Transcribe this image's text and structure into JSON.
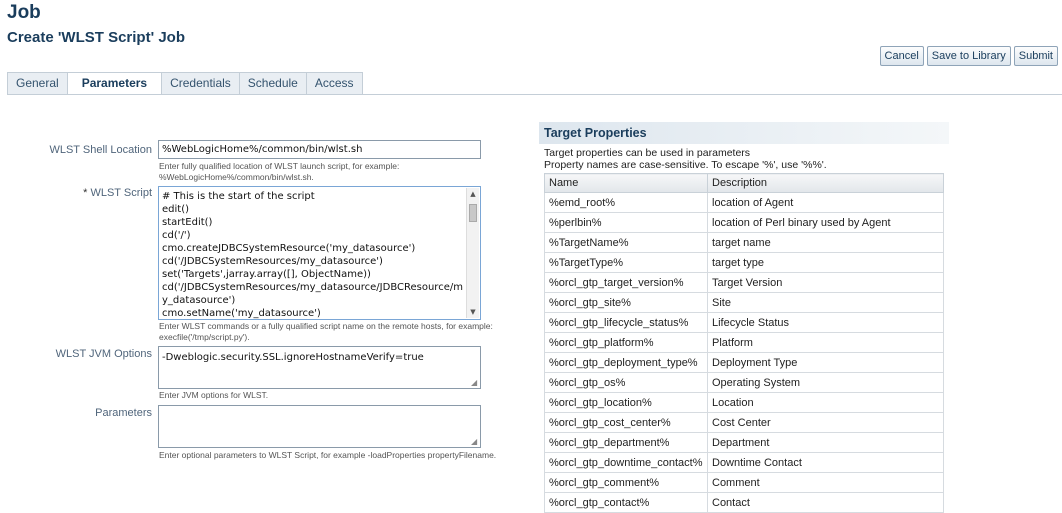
{
  "header": {
    "title": "Job",
    "subtitle": "Create 'WLST Script' Job"
  },
  "actions": {
    "cancel": "Cancel",
    "save_library": "Save to Library",
    "submit": "Submit"
  },
  "tabs": [
    "General",
    "Parameters",
    "Credentials",
    "Schedule",
    "Access"
  ],
  "form": {
    "shell_label": "WLST Shell Location",
    "shell_value": "%WebLogicHome%/common/bin/wlst.sh",
    "shell_hint_1": "Enter fully qualified location of WLST launch script, for example:",
    "shell_hint_2": "%WebLogicHome%/common/bin/wlst.sh.",
    "script_label": "WLST Script",
    "script_required": "*",
    "script_lines": [
      "# This is the start of the script",
      "edit()",
      "startEdit()",
      "cd('/')",
      "cmo.createJDBCSystemResource('my_datasource')",
      "cd('/JDBCSystemResources/my_datasource')",
      "set('Targets',jarray.array([], ObjectName))",
      "cd('/JDBCSystemResources/my_datasource/JDBCResource/m",
      "y_datasource')",
      "cmo.setName('my_datasource')"
    ],
    "script_hint_1": "Enter WLST commands or a fully qualified script name on the remote hosts, for example:",
    "script_hint_2": "execfile('/tmp/script.py').",
    "jvm_label": "WLST JVM Options",
    "jvm_value": "-Dweblogic.security.SSL.ignoreHostnameVerify=true",
    "jvm_hint": "Enter JVM options for WLST.",
    "params_label": "Parameters",
    "params_value": "",
    "params_hint": "Enter optional parameters to WLST Script, for example -loadProperties propertyFilename."
  },
  "target_properties": {
    "title": "Target Properties",
    "desc_1": "Target properties can be used in parameters",
    "desc_2": "Property names are case-sensitive. To escape '%', use '%%'.",
    "columns": [
      "Name",
      "Description"
    ],
    "rows": [
      [
        "%emd_root%",
        "location of Agent"
      ],
      [
        "%perlbin%",
        "location of Perl binary used by Agent"
      ],
      [
        "%TargetName%",
        "target name"
      ],
      [
        "%TargetType%",
        "target type"
      ],
      [
        "%orcl_gtp_target_version%",
        "Target Version"
      ],
      [
        "%orcl_gtp_site%",
        "Site"
      ],
      [
        "%orcl_gtp_lifecycle_status%",
        "Lifecycle Status"
      ],
      [
        "%orcl_gtp_platform%",
        "Platform"
      ],
      [
        "%orcl_gtp_deployment_type%",
        "Deployment Type"
      ],
      [
        "%orcl_gtp_os%",
        "Operating System"
      ],
      [
        "%orcl_gtp_location%",
        "Location"
      ],
      [
        "%orcl_gtp_cost_center%",
        "Cost Center"
      ],
      [
        "%orcl_gtp_department%",
        "Department"
      ],
      [
        "%orcl_gtp_downtime_contact%",
        "Downtime Contact"
      ],
      [
        "%orcl_gtp_comment%",
        "Comment"
      ],
      [
        "%orcl_gtp_contact%",
        "Contact"
      ]
    ]
  }
}
